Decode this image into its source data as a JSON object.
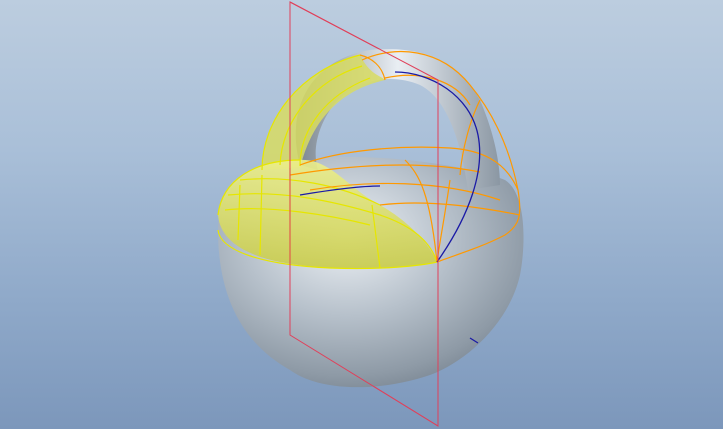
{
  "viewport": {
    "description_label": "",
    "background_top": "#bccddf",
    "background_bottom": "#7c97bb"
  },
  "model": {
    "surface_color": "#b9c2cc",
    "highlight_color_yellow": "#e5e866",
    "edge_color_yellow": "#e6e600",
    "edge_color_orange": "#ff9900",
    "datum_plane_color": "#e0405a",
    "curve_color_blue": "#1a1aa6"
  }
}
